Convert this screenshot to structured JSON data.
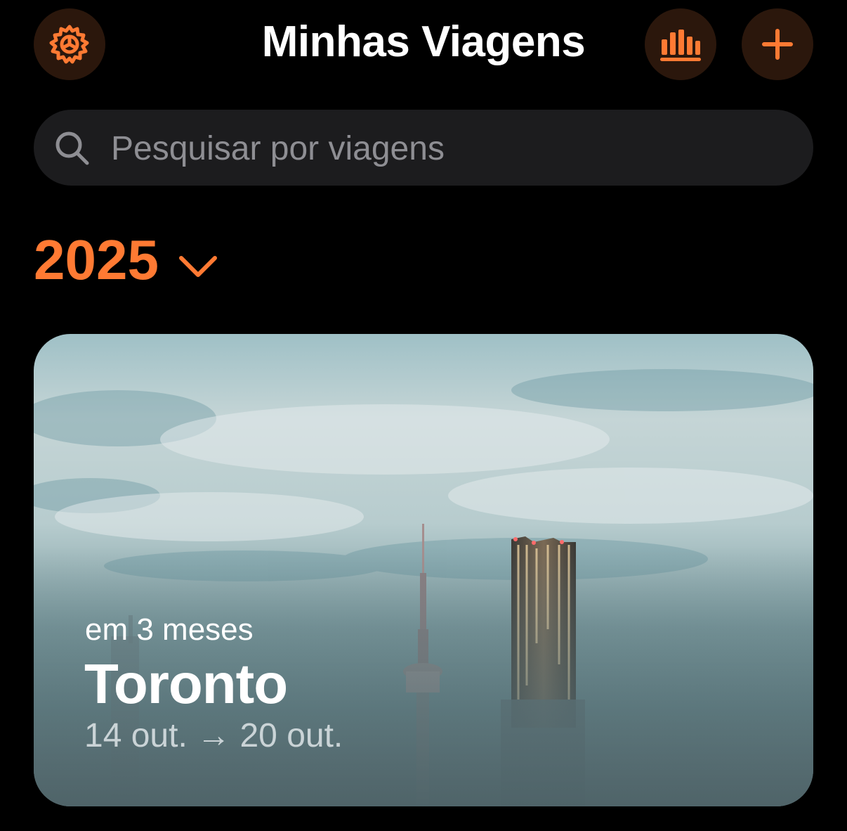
{
  "header": {
    "title": "Minhas Viagens",
    "settings_icon": "gear-icon",
    "stats_icon": "bar-chart-icon",
    "add_icon": "plus-icon"
  },
  "search": {
    "placeholder": "Pesquisar por viagens",
    "value": ""
  },
  "year_selector": {
    "year": "2025"
  },
  "trips": [
    {
      "relative_time": "em 3 meses",
      "destination": "Toronto",
      "dates": "14 out. → 20 out."
    }
  ],
  "colors": {
    "accent": "#ff7a33",
    "button_bg": "#2b170c",
    "search_bg": "#1c1c1e",
    "background": "#000000"
  }
}
